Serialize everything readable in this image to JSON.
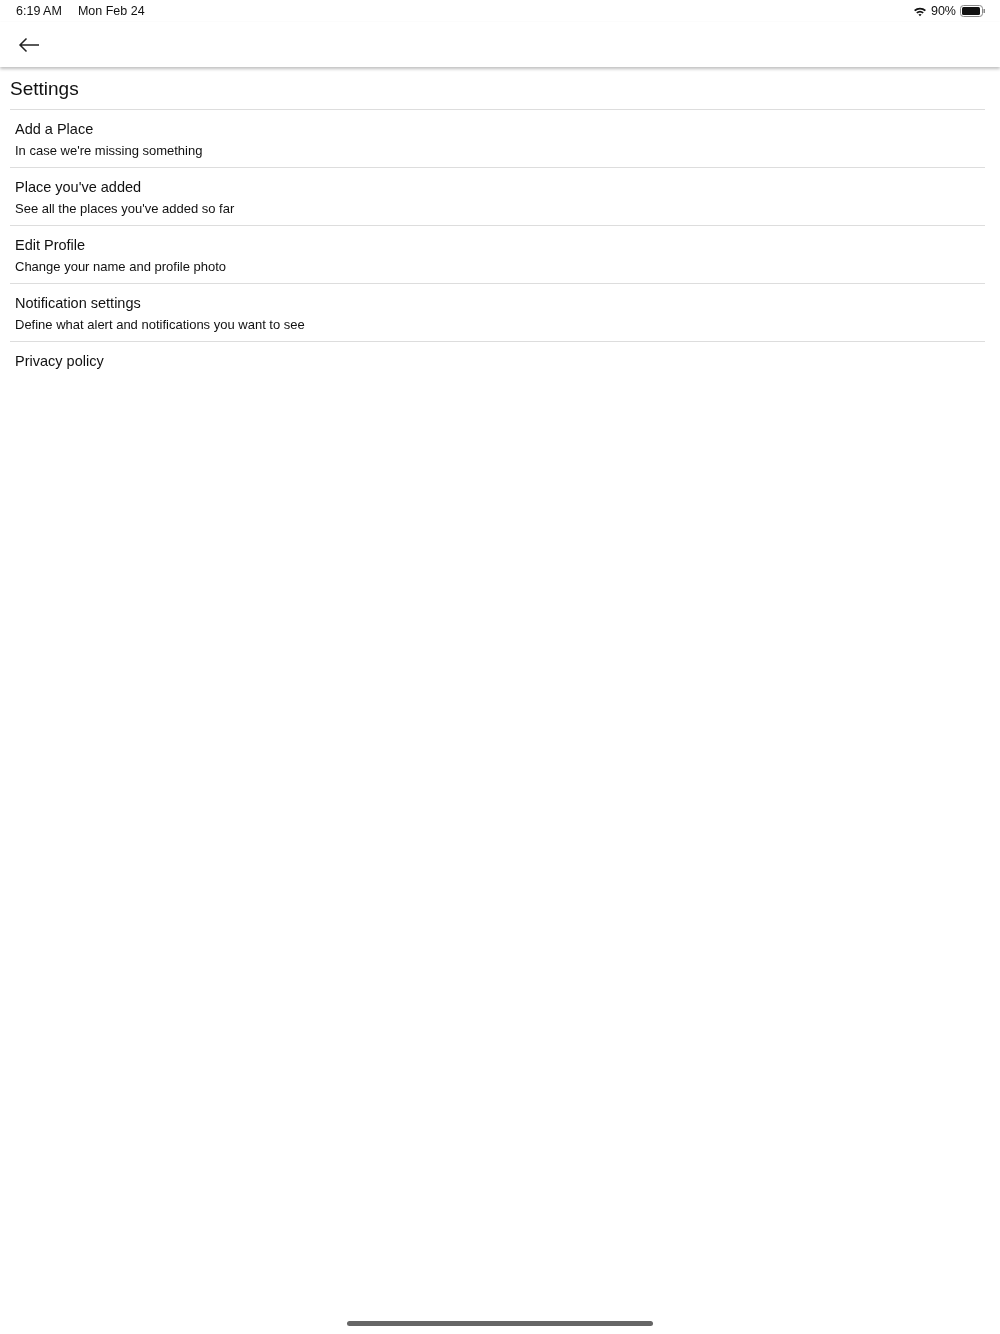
{
  "status_bar": {
    "time": "6:19 AM",
    "date": "Mon Feb 24",
    "battery": "90%"
  },
  "header": {
    "title": "Settings"
  },
  "items": [
    {
      "title": "Add a Place",
      "subtitle": "In case we're missing something"
    },
    {
      "title": "Place you've added",
      "subtitle": "See all the places you've added so far"
    },
    {
      "title": "Edit Profile",
      "subtitle": "Change your name and profile photo"
    },
    {
      "title": "Notification settings",
      "subtitle": "Define what alert and notifications you want to see"
    },
    {
      "title": "Privacy policy"
    }
  ]
}
